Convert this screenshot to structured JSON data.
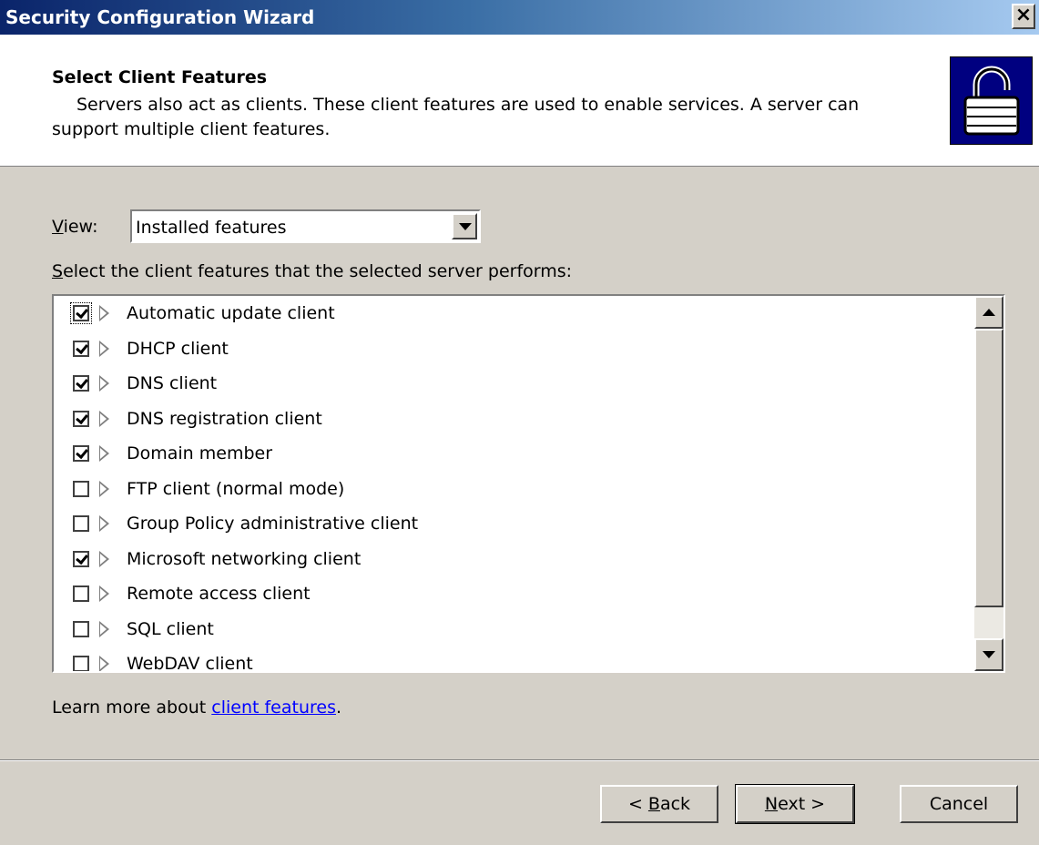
{
  "window": {
    "title": "Security Configuration Wizard",
    "close_label": "×"
  },
  "header": {
    "title": "Select Client Features",
    "description_line1": "Servers also act as clients. These client features are used to enable services. A server can",
    "description_line2": "support multiple client features.",
    "icon": "padlock-icon"
  },
  "view": {
    "label_hotkey": "V",
    "label_rest": "iew:",
    "selected": "Installed features"
  },
  "list": {
    "label_hotkey": "S",
    "label_rest": "elect the client features that the selected server performs:",
    "items": [
      {
        "label": "Automatic update client",
        "checked": true
      },
      {
        "label": "DHCP client",
        "checked": true
      },
      {
        "label": "DNS client",
        "checked": true
      },
      {
        "label": "DNS registration client",
        "checked": true
      },
      {
        "label": "Domain member",
        "checked": true
      },
      {
        "label": "FTP client (normal mode)",
        "checked": false
      },
      {
        "label": "Group Policy administrative client",
        "checked": false
      },
      {
        "label": "Microsoft networking client",
        "checked": true
      },
      {
        "label": "Remote access client",
        "checked": false
      },
      {
        "label": "SQL client",
        "checked": false
      },
      {
        "label": "WebDAV client",
        "checked": false
      }
    ]
  },
  "learn_more": {
    "prefix": "Learn more about ",
    "link": "client features",
    "suffix": "."
  },
  "buttons": {
    "back_prefix": "< ",
    "back_hotkey": "B",
    "back_rest": "ack",
    "next_hotkey": "N",
    "next_rest": "ext >",
    "cancel": "Cancel"
  },
  "colors": {
    "title_start": "#0a246a",
    "title_end": "#a6caf0",
    "face": "#d4d0c8",
    "link": "#0000ff",
    "logo_bg": "#000080"
  }
}
